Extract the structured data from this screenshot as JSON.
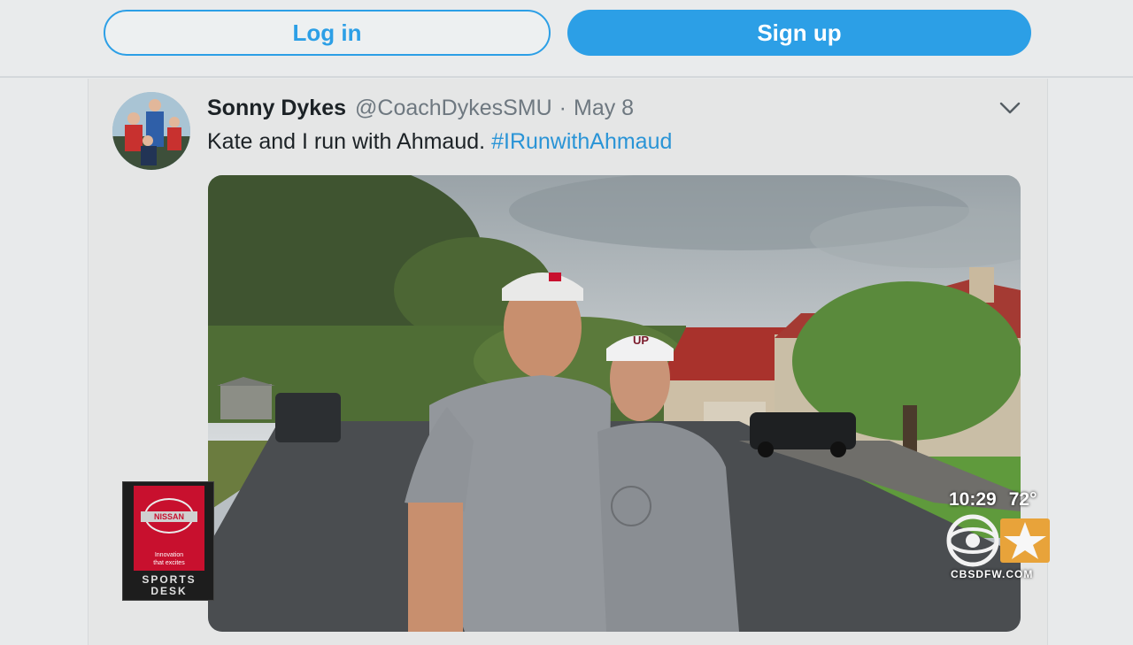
{
  "auth": {
    "login_label": "Log in",
    "signup_label": "Sign up"
  },
  "tweet": {
    "display_name": "Sonny Dykes",
    "handle": "@CoachDykesSMU",
    "separator": "·",
    "date": "May 8",
    "text": "Kate and I run with Ahmaud.",
    "hashtag": "#IRunwithAhmaud",
    "photo_cap_labels": {
      "left_cap": "",
      "right_cap": "UP"
    }
  },
  "sponsor": {
    "brand": "NISSAN",
    "tagline_1": "Innovation",
    "tagline_2": "that excites",
    "sports_1": "SPORTS",
    "sports_2": "DESK"
  },
  "broadcast": {
    "time": "10:29",
    "temperature": "72°",
    "website": "CBSDFW.COM"
  },
  "icons": {
    "avatar": "avatar",
    "tweet_menu": "chevron-down-icon",
    "station_logo": "cbs-11-logo"
  },
  "colors": {
    "accent": "#2c9fe6",
    "hashtag": "#2a94d6",
    "nissan_red": "#c8102e"
  }
}
